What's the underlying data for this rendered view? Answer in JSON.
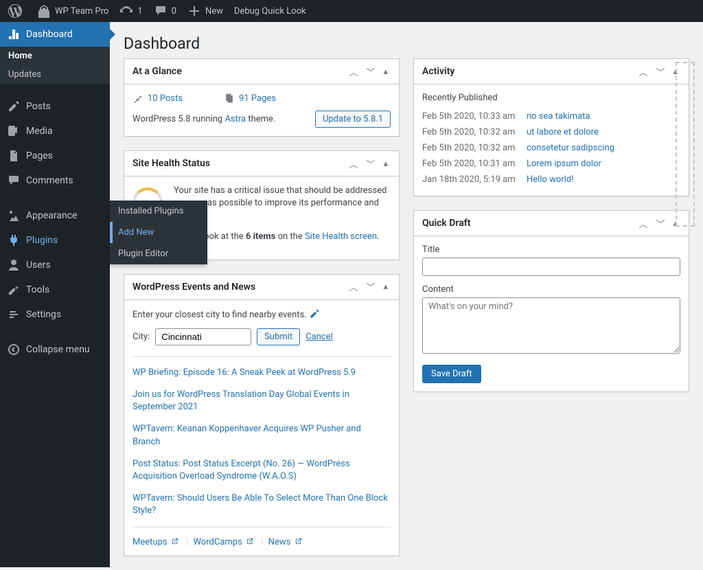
{
  "adminbar": {
    "site_name": "WP Team Pro",
    "updates": "1",
    "comments": "0",
    "new": "New",
    "debug": "Debug Quick Look"
  },
  "sidebar": {
    "dashboard": "Dashboard",
    "home": "Home",
    "updates": "Updates",
    "posts": "Posts",
    "media": "Media",
    "pages": "Pages",
    "comments": "Comments",
    "appearance": "Appearance",
    "plugins": "Plugins",
    "users": "Users",
    "tools": "Tools",
    "settings": "Settings",
    "collapse": "Collapse menu",
    "flyout": {
      "installed": "Installed Plugins",
      "add_new": "Add New",
      "editor": "Plugin Editor"
    }
  },
  "page_title": "Dashboard",
  "glance": {
    "title": "At a Glance",
    "posts": "10 Posts",
    "pages": "91 Pages",
    "version_pre": "WordPress 5.8 running ",
    "theme": "Astra",
    "version_post": " theme.",
    "update_btn": "Update to 5.8.1"
  },
  "health": {
    "title": "Site Health Status",
    "line1": "Your site has a critical issue that should be addressed as soon as possible to improve its performance and security.",
    "line2_pre": "Take a look at the ",
    "line2_bold": "6 items",
    "line2_mid": " on the ",
    "line2_link": "Site Health screen",
    "line2_post": "."
  },
  "events": {
    "title": "WordPress Events and News",
    "hint": "Enter your closest city to find nearby events.",
    "city_label": "City:",
    "city_value": "Cincinnati",
    "submit": "Submit",
    "cancel": "Cancel",
    "items": [
      "WP Briefing: Episode 16: A Sneak Peek at WordPress 5.9",
      "Join us for WordPress Translation Day Global Events in September 2021",
      "WPTavern: Keanan Koppenhaver Acquires WP Pusher and Branch",
      "Post Status: Post Status Excerpt (No. 26) — WordPress Acquisition Overload Syndrome (W.A.O.S)",
      "WPTavern: Should Users Be Able To Select More Than One Block Style?"
    ],
    "meetups": "Meetups",
    "wordcamps": "WordCamps",
    "news": "News"
  },
  "activity": {
    "title": "Activity",
    "recently": "Recently Published",
    "rows": [
      {
        "date": "Feb 5th 2020, 10:33 am",
        "title": "no sea takimata"
      },
      {
        "date": "Feb 5th 2020, 10:32 am",
        "title": "ut labore et dolore"
      },
      {
        "date": "Feb 5th 2020, 10:32 am",
        "title": "consetetur sadipscing"
      },
      {
        "date": "Feb 5th 2020, 10:31 am",
        "title": "Lorem ipsum dolor"
      },
      {
        "date": "Jan 18th 2020, 5:19 am",
        "title": "Hello world!"
      }
    ]
  },
  "draft": {
    "title": "Quick Draft",
    "title_label": "Title",
    "content_label": "Content",
    "placeholder": "What's on your mind?",
    "save": "Save Draft"
  }
}
